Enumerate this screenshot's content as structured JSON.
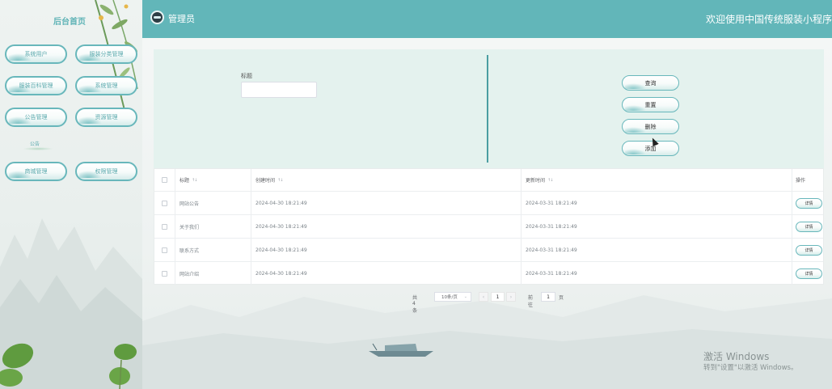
{
  "sidebar": {
    "title": "后台首页",
    "menu": [
      {
        "label": "系统用户"
      },
      {
        "label": "服装分类管理"
      },
      {
        "label": "服装百科管理"
      },
      {
        "label": "系统管理"
      },
      {
        "label": "公告管理"
      },
      {
        "label": "资源管理"
      },
      {
        "label": "商城管理"
      },
      {
        "label": "权限管理"
      }
    ],
    "submenu_label": "公告"
  },
  "header": {
    "role": "管理员",
    "welcome": "欢迎使用中国传统服装小程序"
  },
  "search": {
    "label": "标题",
    "value": "",
    "buttons": {
      "query": "查询",
      "reset": "重置",
      "delete": "删除",
      "add": "添加"
    }
  },
  "table": {
    "headers": {
      "title": "标题",
      "created": "创建时间",
      "updated": "更新时间",
      "operation": "操作"
    },
    "sort_icon": "↑↓",
    "detail_label": "详情",
    "rows": [
      {
        "title": "网站公告",
        "created": "2024-04-30 18:21:49",
        "updated": "2024-03-31 18:21:49"
      },
      {
        "title": "关于我们",
        "created": "2024-04-30 18:21:49",
        "updated": "2024-03-31 18:21:49"
      },
      {
        "title": "联系方式",
        "created": "2024-04-30 18:21:49",
        "updated": "2024-03-31 18:21:49"
      },
      {
        "title": "网站介绍",
        "created": "2024-04-30 18:21:49",
        "updated": "2024-03-31 18:21:49"
      }
    ]
  },
  "pagination": {
    "total": "共 4 条",
    "page_size": "10条/页",
    "current_page": "1",
    "goto_label": "前往",
    "goto_value": "1",
    "page_suffix": "页",
    "prev": "‹",
    "next": "›"
  },
  "watermark": {
    "title": "激活 Windows",
    "subtitle": "转到\"设置\"以激活 Windows。"
  },
  "colors": {
    "accent": "#62b6b9",
    "panel": "#e4f2ee",
    "divider": "#4b9ea2"
  },
  "icons": {
    "avatar": "avatar-icon",
    "sort": "sort-icon",
    "caret": "chevron-down-icon"
  }
}
